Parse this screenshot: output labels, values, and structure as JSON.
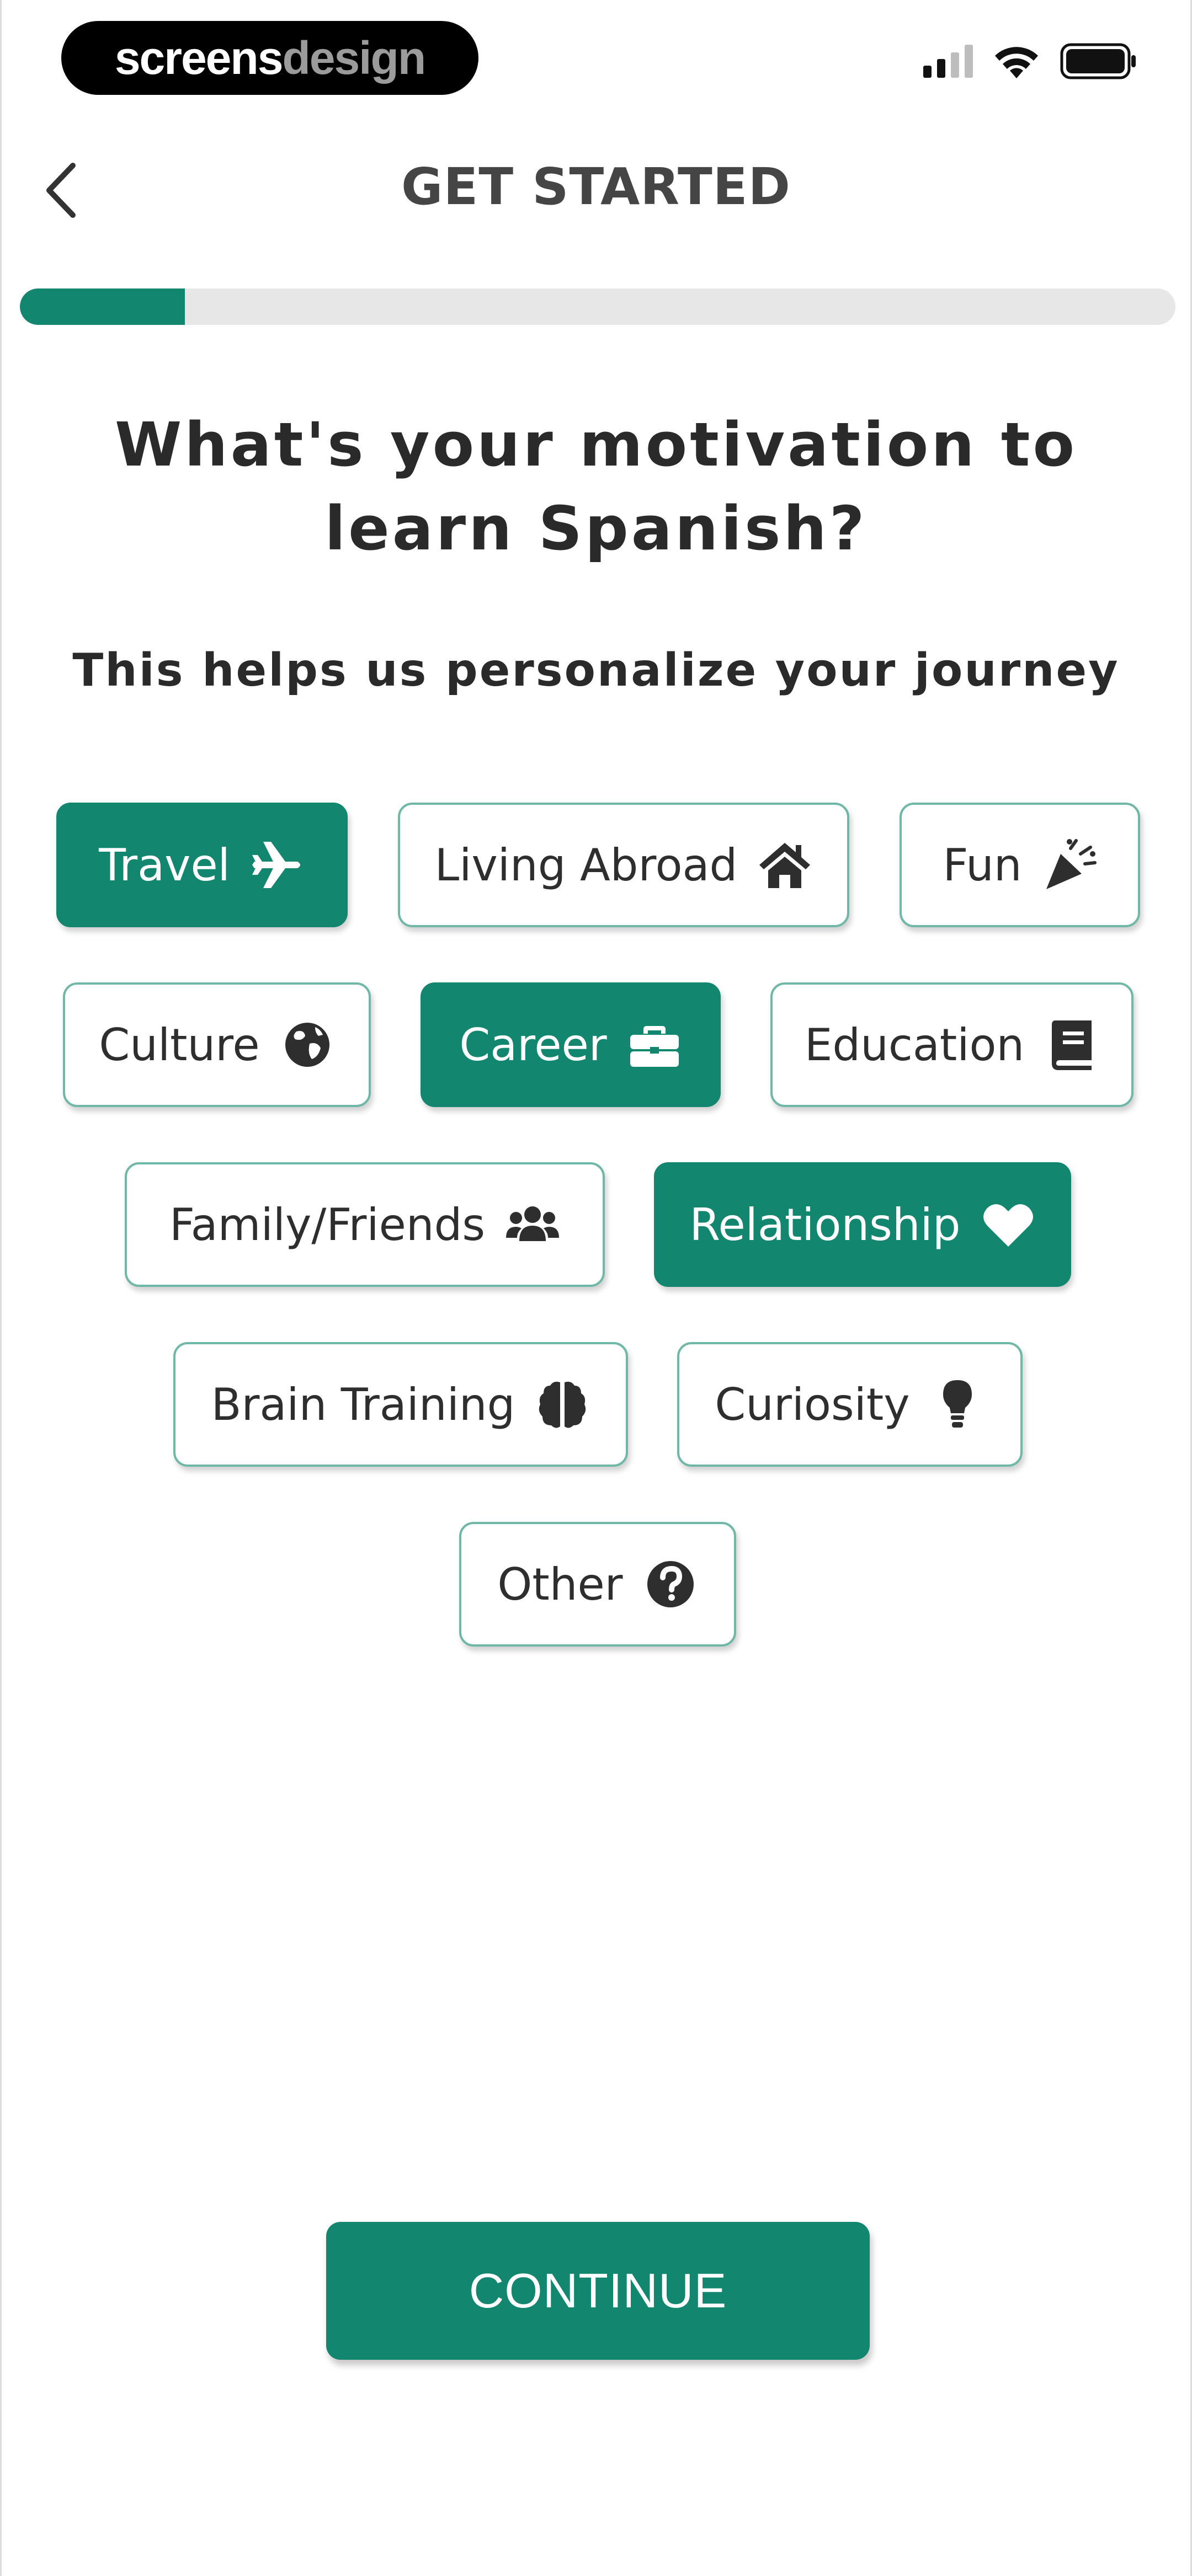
{
  "status_bar": {
    "brand_part1": "screens",
    "brand_part2": "design"
  },
  "header": {
    "title": "GET STARTED"
  },
  "progress": {
    "fraction": 0.143
  },
  "question": "What's your motivation to learn Spanish?",
  "subtitle": "This helps us personalize your journey",
  "colors": {
    "accent": "#13866f",
    "chip_border": "#6fb7a6"
  },
  "chips": [
    {
      "label": "Travel",
      "icon": "airplane-icon",
      "selected": true
    },
    {
      "label": "Living Abroad",
      "icon": "house-icon",
      "selected": false
    },
    {
      "label": "Fun",
      "icon": "party-popper-icon",
      "selected": false
    },
    {
      "label": "Culture",
      "icon": "globe-icon",
      "selected": false
    },
    {
      "label": "Career",
      "icon": "briefcase-icon",
      "selected": true
    },
    {
      "label": "Education",
      "icon": "book-icon",
      "selected": false
    },
    {
      "label": "Family/Friends",
      "icon": "users-icon",
      "selected": false
    },
    {
      "label": "Relationship",
      "icon": "heart-icon",
      "selected": true
    },
    {
      "label": "Brain Training",
      "icon": "brain-icon",
      "selected": false
    },
    {
      "label": "Curiosity",
      "icon": "lightbulb-icon",
      "selected": false
    },
    {
      "label": "Other",
      "icon": "question-circle-icon",
      "selected": false
    }
  ],
  "continue_label": "CONTINUE"
}
